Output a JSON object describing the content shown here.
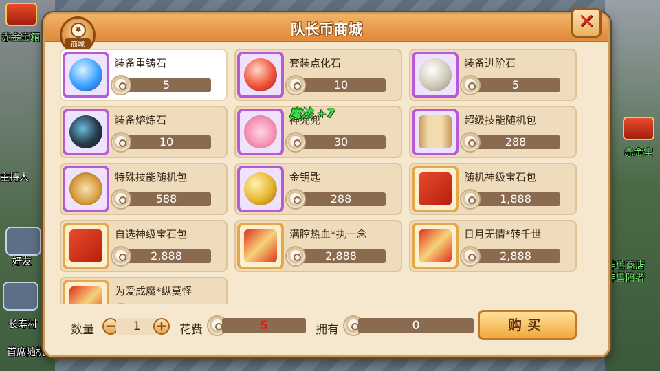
{
  "shop": {
    "title": "队长币商城",
    "badge_label": "商城",
    "badge_symbol": "¥"
  },
  "items": [
    {
      "name": "装备重铸石",
      "price": "5",
      "frame": "purple",
      "art": "blue-orb",
      "selected": true
    },
    {
      "name": "套装点化石",
      "price": "10",
      "frame": "purple",
      "art": "red-orb"
    },
    {
      "name": "装备进阶石",
      "price": "5",
      "frame": "purple",
      "art": "silver-orb"
    },
    {
      "name": "装备熔炼石",
      "price": "10",
      "frame": "purple",
      "art": "dark-orb"
    },
    {
      "name": "神兜兜",
      "price": "30",
      "frame": "purple",
      "art": "pig"
    },
    {
      "name": "超级技能随机包",
      "price": "288",
      "frame": "purple",
      "art": "scroll"
    },
    {
      "name": "特殊技能随机包",
      "price": "588",
      "frame": "purple",
      "art": "yin-yang"
    },
    {
      "name": "金钥匙",
      "price": "288",
      "frame": "purple",
      "art": "key"
    },
    {
      "name": "随机神级宝石包",
      "price": "1,888",
      "frame": "gold",
      "art": "gift"
    },
    {
      "name": "自选神级宝石包",
      "price": "2,888",
      "frame": "gold",
      "art": "gift"
    },
    {
      "name": "满腔热血*执一念",
      "price": "2,888",
      "frame": "gold",
      "art": "card"
    },
    {
      "name": "日月无情*转千世",
      "price": "2,888",
      "frame": "gold",
      "art": "card"
    },
    {
      "name": "为爱成魔*纵莫怪",
      "price": "",
      "frame": "gold",
      "art": "card"
    }
  ],
  "float_text": "魔法 +7",
  "bottom": {
    "quantity_label": "数量",
    "quantity_value": "1",
    "minus": "−",
    "plus": "+",
    "cost_label": "花费",
    "cost_value": "5",
    "owned_label": "拥有",
    "owned_value": "0",
    "buy_label": "购买"
  },
  "background": {
    "left_texts": [
      "赤金宝箱",
      "主持人",
      "好友",
      "长寿村",
      "首席随机"
    ],
    "right_texts": [
      "赤金宝",
      "神兽商店",
      "神兽陪者"
    ]
  }
}
